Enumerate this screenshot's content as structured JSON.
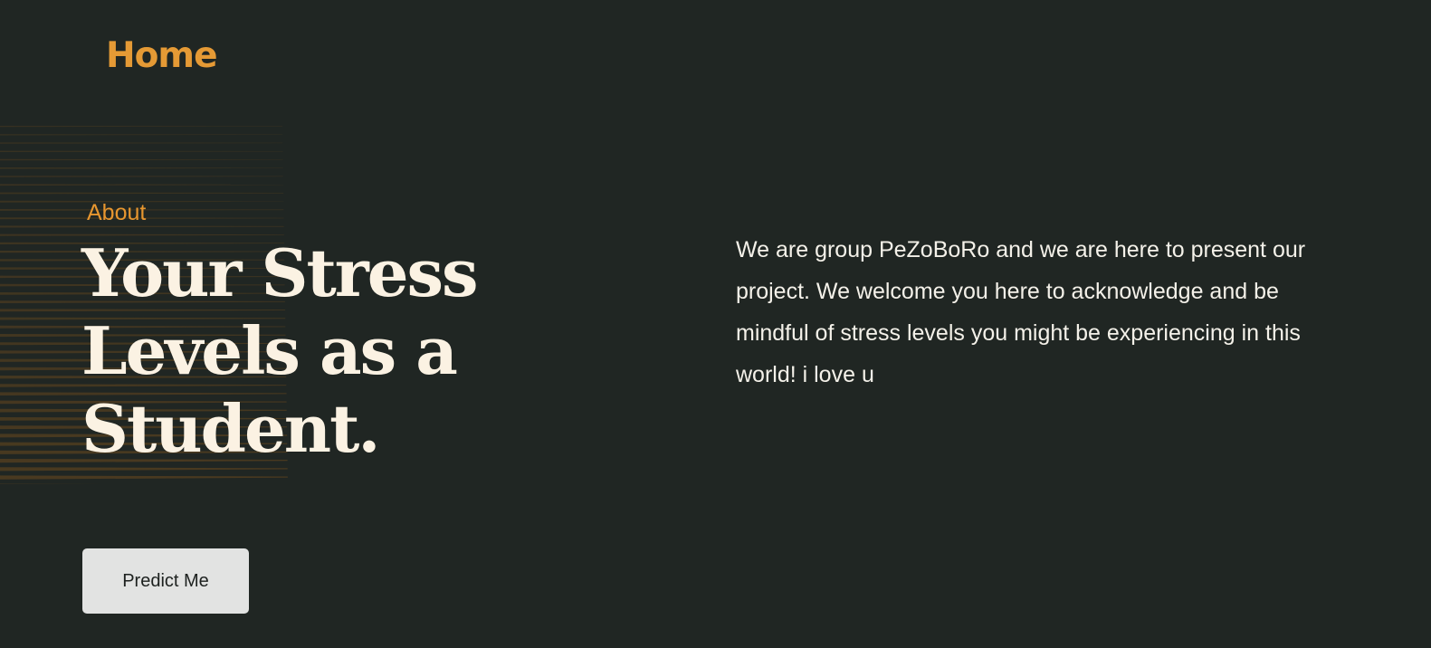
{
  "nav": {
    "brand_label": "Home"
  },
  "hero": {
    "eyebrow": "About",
    "title": "Your Stress Levels as a Student.",
    "description": "We are group PeZoBoRo and we are here to present our project. We welcome you here to acknowledge and be mindful of stress levels you might be experiencing in this world! i love u",
    "cta_label": "Predict Me"
  },
  "colors": {
    "background": "#202623",
    "accent": "#e59a35",
    "title_text": "#fbf2e3",
    "body_text": "#f4f1e9",
    "button_bg": "#e2e3e2",
    "stripe": "#4a3a20"
  }
}
